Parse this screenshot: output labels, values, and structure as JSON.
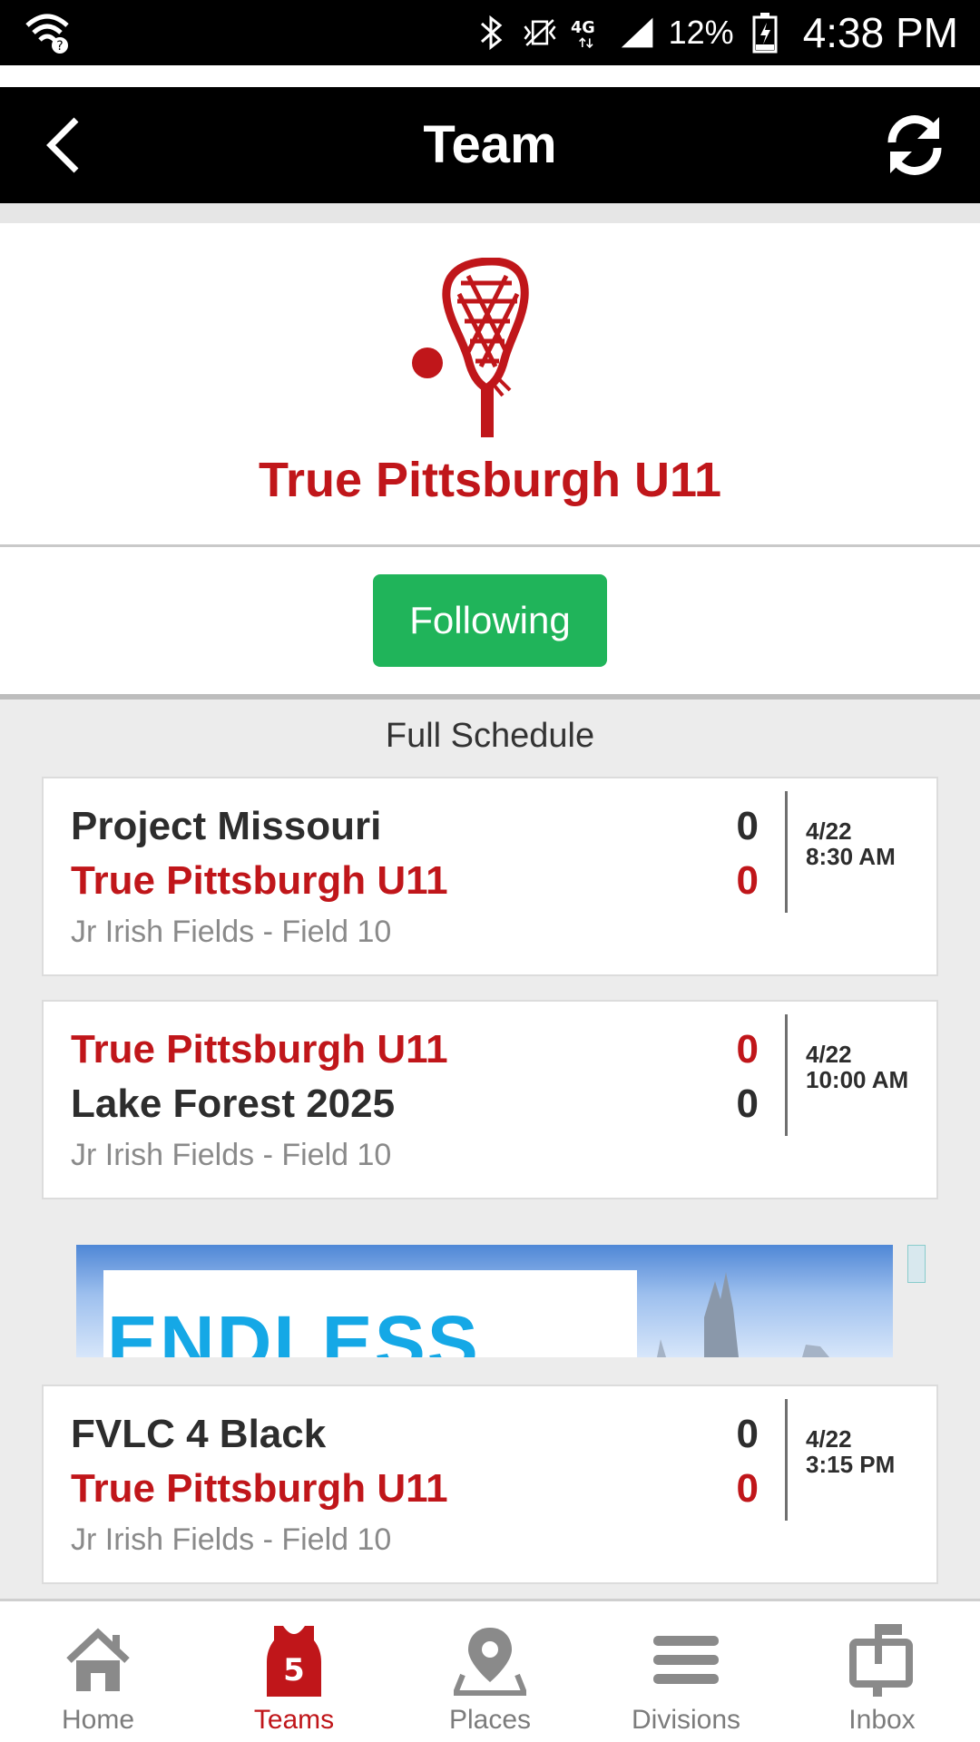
{
  "status_bar": {
    "battery": "12%",
    "time": "4:38 PM",
    "network": "4G"
  },
  "header": {
    "title": "Team"
  },
  "team": {
    "name": "True Pittsburgh U11",
    "follow_label": "Following"
  },
  "schedule": {
    "title": "Full Schedule",
    "games": [
      {
        "top_team": "Project Missouri",
        "top_score": "0",
        "bottom_team": "True Pittsburgh U11",
        "bottom_score": "0",
        "date": "4/22",
        "time": "8:30 AM",
        "venue": "Jr Irish Fields - Field 10"
      },
      {
        "top_team": "True Pittsburgh U11",
        "top_score": "0",
        "bottom_team": "Lake Forest 2025",
        "bottom_score": "0",
        "date": "4/22",
        "time": "10:00 AM",
        "venue": "Jr Irish Fields - Field 10"
      },
      {
        "top_team": "FVLC 4 Black",
        "top_score": "0",
        "bottom_team": "True Pittsburgh U11",
        "bottom_score": "0",
        "date": "4/22",
        "time": "3:15 PM",
        "venue": "Jr Irish Fields - Field 10"
      }
    ]
  },
  "ad": {
    "text": "ENDLESS"
  },
  "nav": {
    "items": [
      {
        "label": "Home",
        "icon": "home-icon"
      },
      {
        "label": "Teams",
        "icon": "jersey-icon",
        "badge": "5"
      },
      {
        "label": "Places",
        "icon": "map-pin-icon"
      },
      {
        "label": "Divisions",
        "icon": "menu-icon"
      },
      {
        "label": "Inbox",
        "icon": "inbox-icon"
      }
    ],
    "active_index": 1
  },
  "colors": {
    "brand_red": "#c0161a",
    "follow_green": "#20b45a",
    "header_bg": "#000000"
  }
}
